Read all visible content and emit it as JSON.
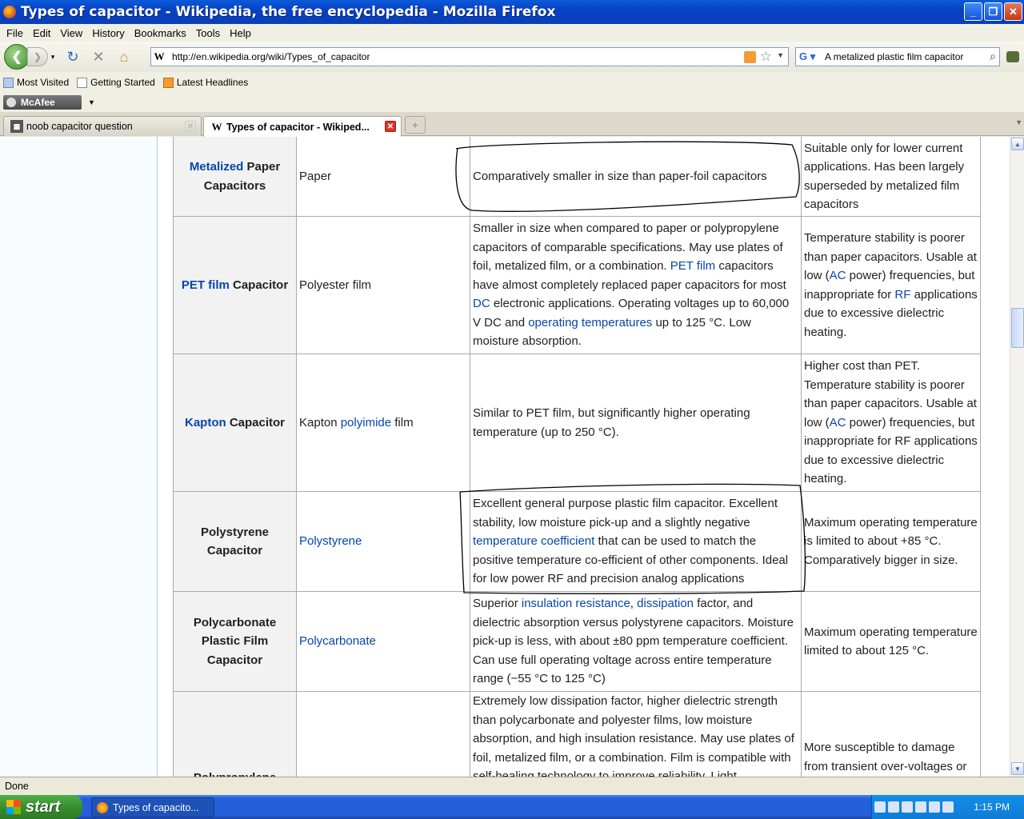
{
  "window": {
    "title": "Types of capacitor - Wikipedia, the free encyclopedia - Mozilla Firefox"
  },
  "menu": [
    "File",
    "Edit",
    "View",
    "History",
    "Bookmarks",
    "Tools",
    "Help"
  ],
  "nav": {
    "url": "http://en.wikipedia.org/wiki/Types_of_capacitor",
    "search_value": "A metalized plastic film capacitor"
  },
  "bookmarks": [
    "Most Visited",
    "Getting Started",
    "Latest Headlines"
  ],
  "toolbar": {
    "mcafee": "McAfee"
  },
  "tabs": [
    {
      "label": "noob capacitor question"
    },
    {
      "label": "Types of capacitor - Wikiped..."
    }
  ],
  "table": {
    "rows": [
      {
        "name_link": "Metalized",
        "name_rest": " Paper Capacitors",
        "material": "Paper",
        "adv": "Comparatively smaller in size than paper-foil capacitors",
        "dis": "Suitable only for lower current applications. Has been largely superseded by metalized film capacitors"
      },
      {
        "name_link": "PET film",
        "name_rest": " Capacitor",
        "material": "Polyester film",
        "adv1": "Smaller in size when compared to paper or polypropylene capacitors of comparable specifications. May use plates of foil, metalized film, or a combination. ",
        "adv_link1": "PET film",
        "adv2": " capacitors have almost completely replaced paper capacitors for most ",
        "adv_link2": "DC",
        "adv3": " electronic applications. Operating voltages up to 60,000 V DC and ",
        "adv_link3": "operating temperatures",
        "adv4": " up to 125 °C. Low moisture absorption.",
        "dis1": "Temperature stability is poorer than paper capacitors. Usable at low (",
        "dis_link1": "AC",
        "dis2": " power) frequencies, but inappropriate for ",
        "dis_link2": "RF",
        "dis3": " applications due to excessive dielectric heating."
      },
      {
        "name_link": "Kapton",
        "name_rest": " Capacitor",
        "material1": "Kapton ",
        "material_link": "polyimide",
        "material2": " film",
        "adv": "Similar to PET film, but significantly higher operating temperature (up to 250 °C).",
        "dis1": "Higher cost than PET. Temperature stability is poorer than paper capacitors. Usable at low (",
        "dis_link1": "AC",
        "dis2": " power) frequencies, but inappropriate for RF applications due to excessive dielectric heating."
      },
      {
        "name": "Polystyrene Capacitor",
        "material_link": "Polystyrene",
        "adv1": "Excellent general purpose plastic film capacitor. Excellent stability, low moisture pick-up and a slightly negative ",
        "adv_link1": "temperature coefficient",
        "adv2": " that can be used to match the positive temperature co-efficient of other components. Ideal for low power RF and precision analog applications",
        "dis": "Maximum operating temperature is limited to about +85 °C. Comparatively bigger in size."
      },
      {
        "name": "Polycarbonate Plastic Film Capacitor",
        "material_link": "Polycarbonate",
        "adv1": "Superior ",
        "adv_link1": "insulation resistance",
        "adv_sep": ", ",
        "adv_link2": "dissipation",
        "adv2": " factor, and dielectric absorption versus polystyrene capacitors. Moisture pick-up is less, with about ±80 ppm temperature coefficient. Can use full operating voltage across entire temperature range (−55 °C to 125 °C)",
        "dis": "Maximum operating temperature limited to about 125 °C."
      },
      {
        "name": "Polypropylene",
        "material": "",
        "adv": "Extremely low dissipation factor, higher dielectric strength than polycarbonate and polyester films, low moisture absorption, and high insulation resistance. May use plates of foil, metalized film, or a combination. Film is compatible with self-healing technology to improve reliability. Light ...",
        "dis": "More susceptible to damage from transient over-voltages or voltage reversals than ..."
      }
    ]
  },
  "status": {
    "text": "Done"
  },
  "taskbar": {
    "start": "start",
    "task": "Types of capacito...",
    "clock": "1:15 PM"
  }
}
